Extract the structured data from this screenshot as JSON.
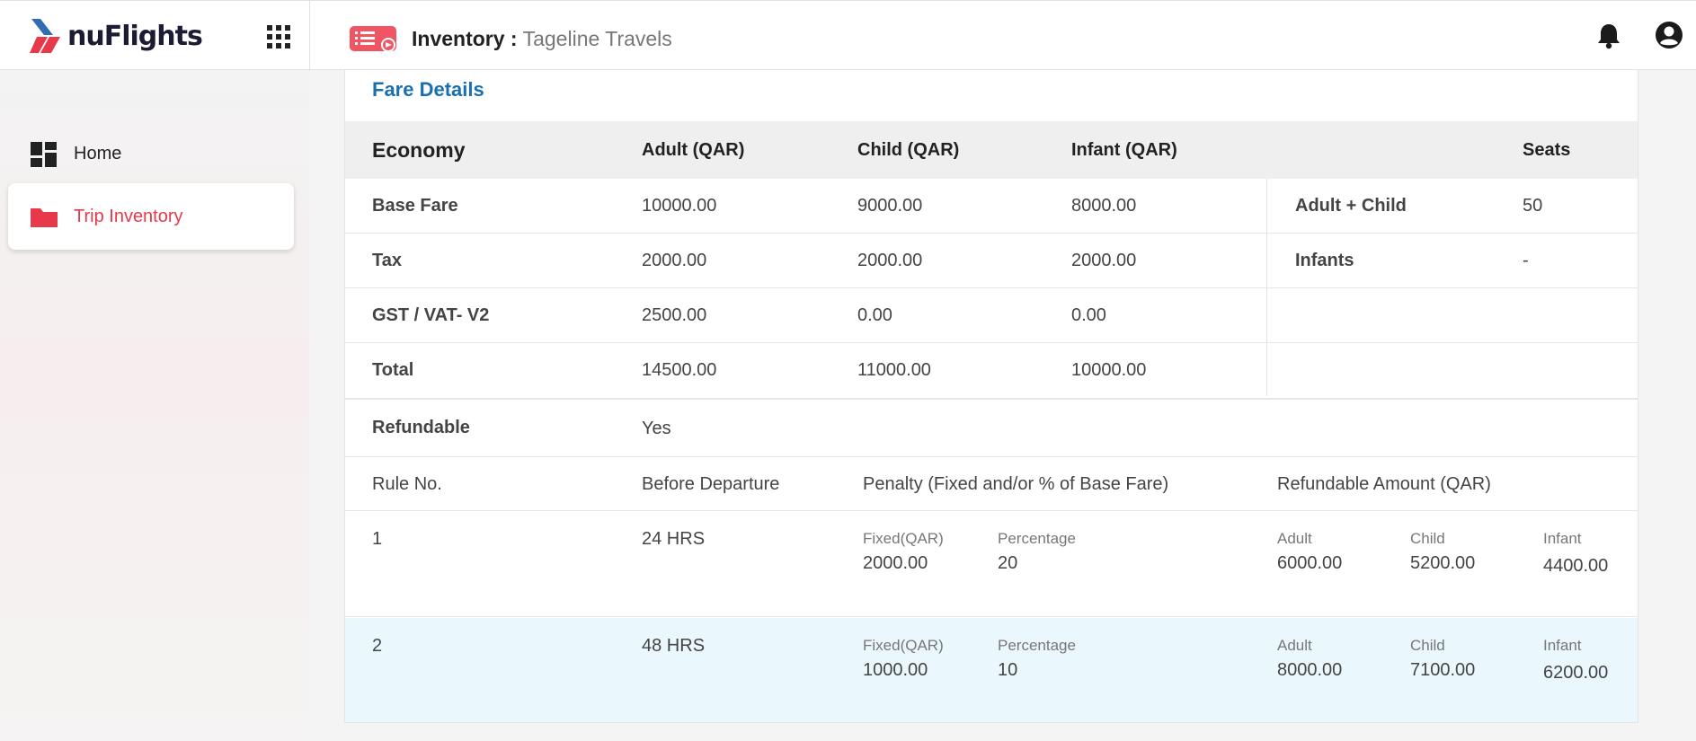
{
  "app": {
    "brand": "nuFlights"
  },
  "header": {
    "title": "Inventory",
    "separator": " :",
    "subtitle": "Tageline Travels"
  },
  "sidebar": {
    "items": [
      {
        "label": "Home",
        "icon": "dashboard-icon"
      },
      {
        "label": "Trip Inventory",
        "icon": "folder-icon",
        "active": true
      }
    ]
  },
  "colors": {
    "accent": "#e8394a",
    "link": "#1a6fb0",
    "highlight_row": "#eaf8fd"
  },
  "fare_details": {
    "title": "Fare Details",
    "cabin": "Economy",
    "columns": [
      "Adult (QAR)",
      "Child (QAR)",
      "Infant (QAR)"
    ],
    "rows": [
      {
        "label": "Base Fare",
        "adult": "10000.00",
        "child": "9000.00",
        "infant": "8000.00"
      },
      {
        "label": "Tax",
        "adult": "2000.00",
        "child": "2000.00",
        "infant": "2000.00"
      },
      {
        "label": "GST / VAT- V2",
        "adult": "2500.00",
        "child": "0.00",
        "infant": "0.00"
      },
      {
        "label": "Total",
        "adult": "14500.00",
        "child": "11000.00",
        "infant": "10000.00"
      }
    ],
    "seats_header": "Seats",
    "seats": [
      {
        "label": "Adult + Child",
        "value": "50"
      },
      {
        "label": "Infants",
        "value": "-"
      }
    ]
  },
  "refundable": {
    "label": "Refundable",
    "value": "Yes"
  },
  "rules": {
    "headers": [
      "Rule No.",
      "Before Departure",
      "Penalty (Fixed and/or % of Base Fare)",
      "Refundable Amount (QAR)"
    ],
    "fixed_label": "Fixed(QAR)",
    "percentage_label": "Percentage",
    "adult_label": "Adult",
    "child_label": "Child",
    "infant_label": "Infant",
    "items": [
      {
        "no": "1",
        "before": "24 HRS",
        "fixed": "2000.00",
        "percentage": "20",
        "adult": "6000.00",
        "child": "5200.00",
        "infant": "4400.00"
      },
      {
        "no": "2",
        "before": "48 HRS",
        "fixed": "1000.00",
        "percentage": "10",
        "adult": "8000.00",
        "child": "7100.00",
        "infant": "6200.00"
      }
    ]
  }
}
